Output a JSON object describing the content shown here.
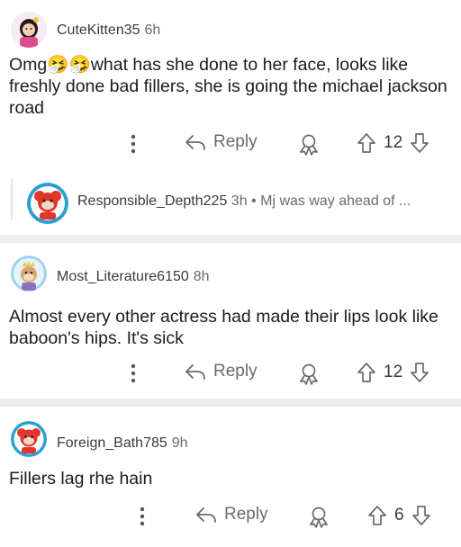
{
  "comments": [
    {
      "username": "CuteKitten35",
      "time": "6h",
      "body_lead": "Omg",
      "body_emoji": "🤧🤧",
      "body_rest": "what has she done to her face, looks like freshly done bad fillers, she is going the michael jackson road",
      "reply_label": "Reply",
      "vote_count": "12",
      "avatar_icon": "cartoon-girl-avatar",
      "reply": {
        "username": "Responsible_Depth225",
        "time": "3h",
        "dot": "•",
        "snippet": "Mj was way ahead of ...",
        "avatar_icon": "red-monkey-avatar"
      }
    },
    {
      "username": "Most_Literature6150",
      "time": "8h",
      "body": "Almost every other actress had made their lips look like  baboon's hips.  It's sick",
      "reply_label": "Reply",
      "vote_count": "12",
      "avatar_icon": "princess-monkey-avatar"
    },
    {
      "username": "Foreign_Bath785",
      "time": "9h",
      "body": "Fillers lag rhe hain",
      "reply_label": "Reply",
      "vote_count": "6",
      "avatar_icon": "red-monkey-avatar"
    }
  ],
  "colors": {
    "separator": "#ededed",
    "meta_text": "#6b6b6d",
    "body_text": "#1c1c1c",
    "avatar_red": "#e0362b",
    "avatar_teal": "#2aa0d0"
  }
}
